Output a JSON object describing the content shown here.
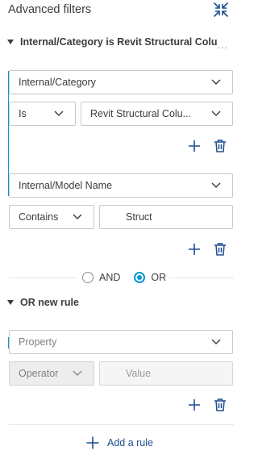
{
  "header": {
    "title": "Advanced filters",
    "collapse_icon": "collapse-arrows-icon"
  },
  "groups": [
    {
      "label": "Internal/Category is Revit Structural Colu",
      "overflow": "...",
      "rules": [
        {
          "property": "Internal/Category",
          "operator": "Is",
          "value": "Revit Structural Colu..."
        },
        {
          "property": "Internal/Model Name",
          "operator": "Contains",
          "value": "Struct"
        }
      ]
    },
    {
      "label": "OR new rule",
      "rules": [
        {
          "property_placeholder": "Property",
          "operator_placeholder": "Operator",
          "value_placeholder": "Value"
        }
      ]
    }
  ],
  "logic": {
    "and_label": "AND",
    "or_label": "OR",
    "selected": "OR"
  },
  "footer": {
    "add_rule_label": "Add a rule"
  },
  "colors": {
    "accent": "#0696d7",
    "link": "#1f4f8f",
    "icon": "#1f4f8f"
  }
}
